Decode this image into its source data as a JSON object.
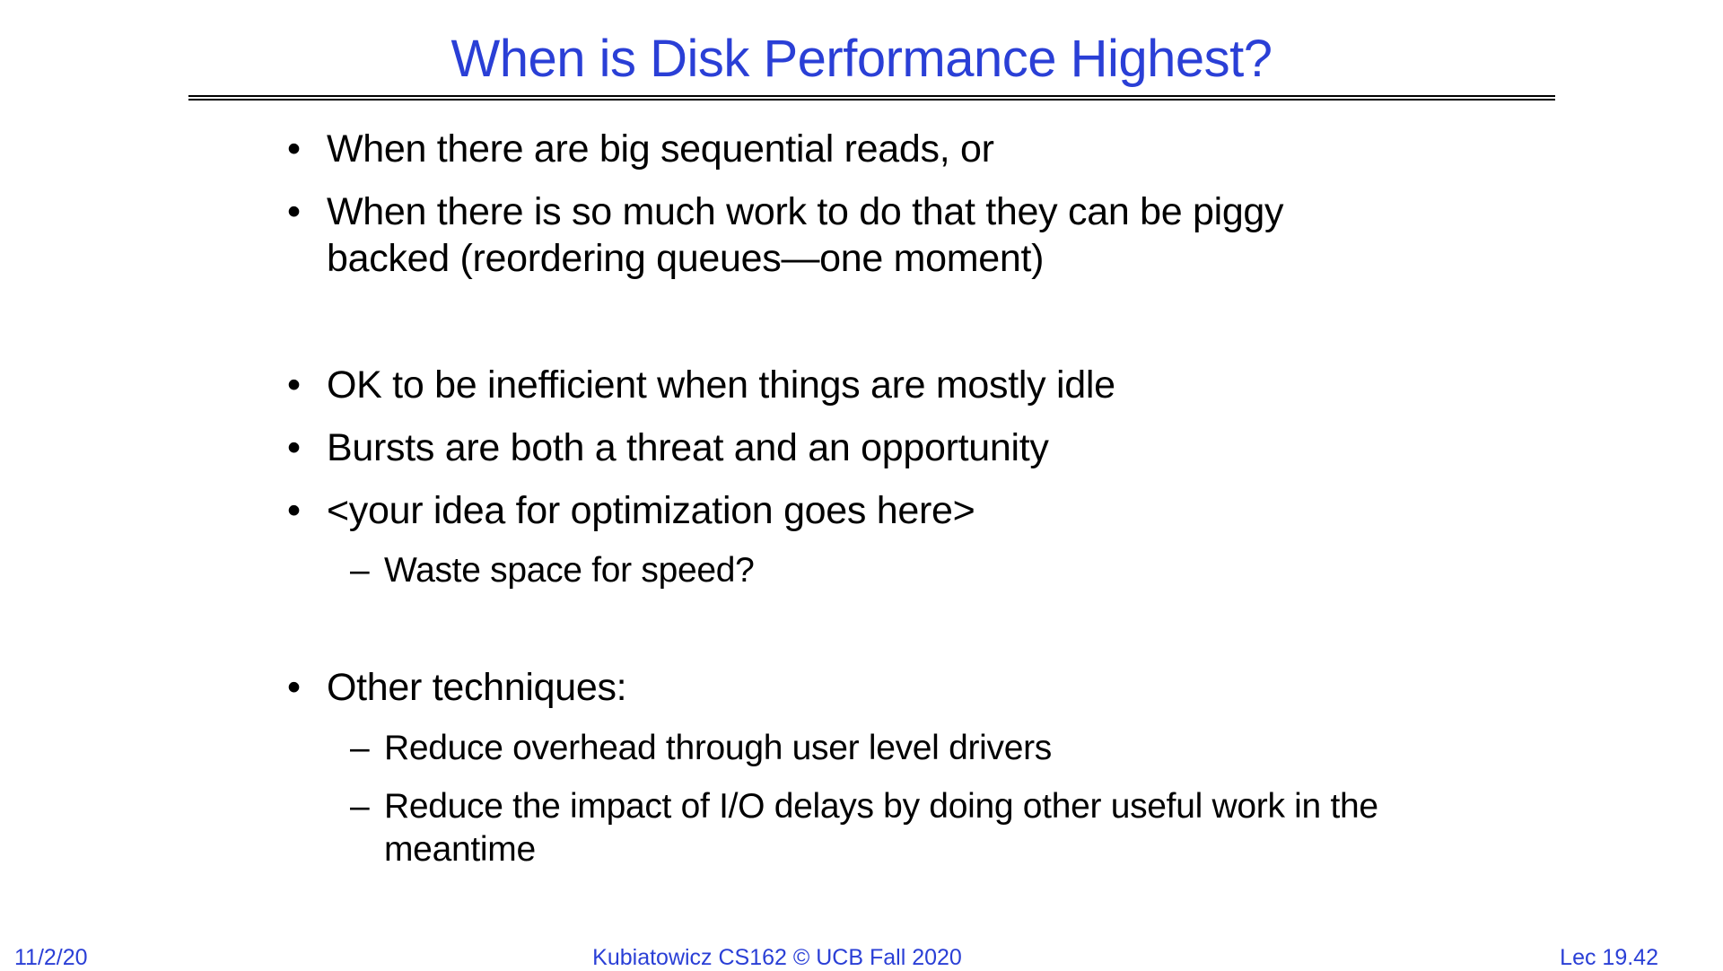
{
  "slide": {
    "title": "When is Disk Performance Highest?",
    "bullet_mark": "•",
    "sub_mark": "–",
    "bullets": [
      {
        "line1": "When there are big sequential reads, or"
      },
      {
        "line1": "When there is so much work to do that they can be piggy",
        "line2": "backed (reordering queues—one moment)"
      },
      {
        "line1": "OK to be inefficient when things are mostly idle"
      },
      {
        "line1": "Bursts are both a threat and an opportunity"
      },
      {
        "line1": "<your idea for optimization goes here>"
      },
      {
        "line1": "Other techniques:"
      }
    ],
    "subs": [
      {
        "line1": "Waste space for speed?"
      },
      {
        "line1": "Reduce overhead through user level drivers"
      },
      {
        "line1": "Reduce the impact of I/O delays by doing other useful work in the",
        "line2": "meantime"
      }
    ]
  },
  "footer": {
    "date": "11/2/20",
    "course": "Kubiatowicz CS162 © UCB Fall 2020",
    "lecture": "Lec 19.42"
  },
  "colors": {
    "accent": "#2a3fd6",
    "text": "#000000",
    "background": "#ffffff"
  }
}
